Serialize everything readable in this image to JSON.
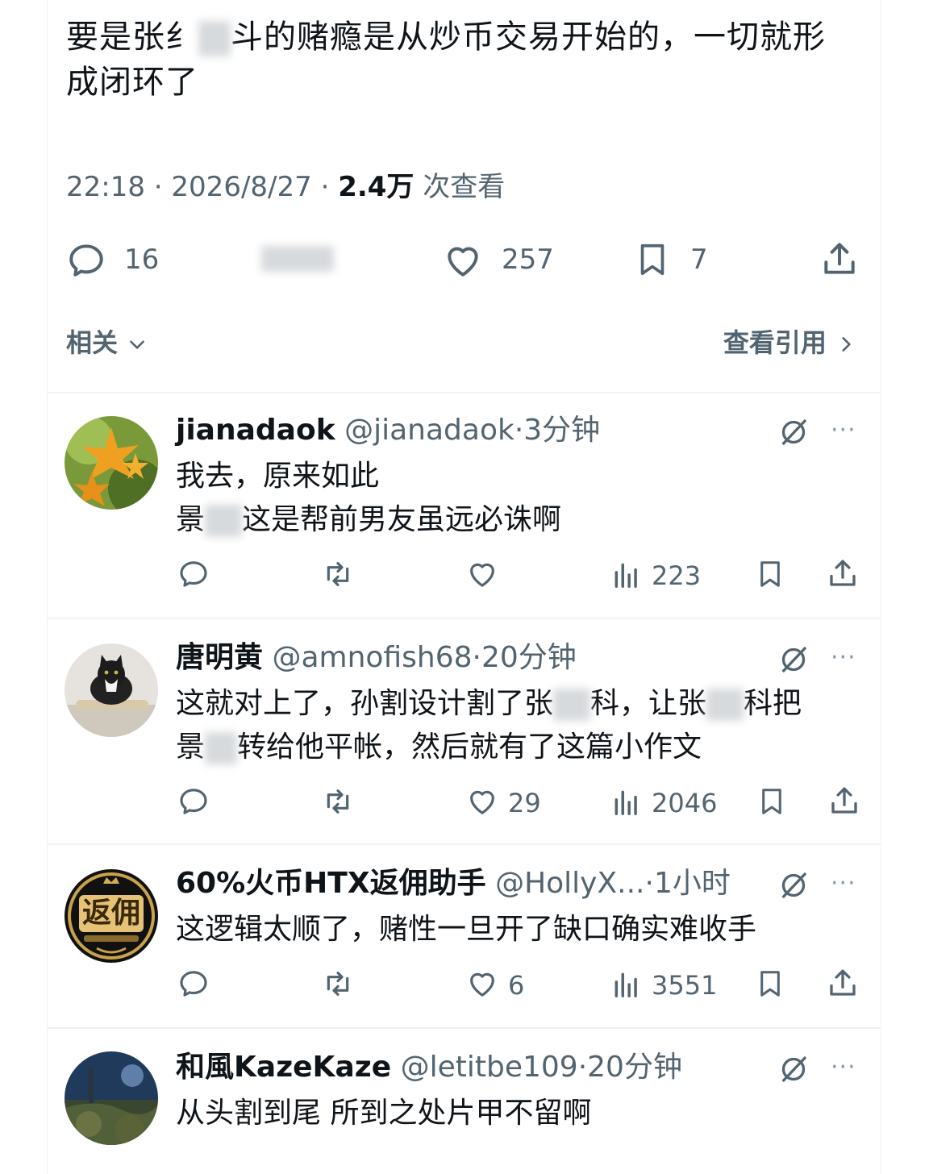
{
  "main_tweet": {
    "text_line1": "要是张纟▢斗的赌瘾是从炒币交易开始的，一切就形",
    "text_line2": "成闭环了",
    "time": "22:18",
    "date": "2026/8/27",
    "sep": "·",
    "views_count": "2.4万",
    "views_label": "次查看",
    "reply_count": "16",
    "like_count": "257",
    "bookmark_count": "7",
    "related_label": "相关",
    "quotes_label": "查看引用"
  },
  "replies": [
    {
      "name": "jianadaok",
      "handle": "@jianadaok",
      "time": "3分钟",
      "line1": "我去，原来如此",
      "line2a": "景",
      "line2b": "这是帮前男友虽远必诛啊",
      "likes": "",
      "views": "223"
    },
    {
      "name": "唐明黄",
      "handle": "@amnofish68",
      "time": "20分钟",
      "line1a": "这就对上了，孙割设计割了张",
      "line1b": "科，让张",
      "line1c": "科把",
      "line2a": "景",
      "line2b": "转给他平帐，然后就有了这篇小作文",
      "likes": "29",
      "views": "2046"
    },
    {
      "name": "60%火币HTX返佣助手",
      "handle": "@HollyX...",
      "time": "1小时",
      "line1": "这逻辑太顺了，赌性一旦开了缺口确实难收手",
      "likes": "6",
      "views": "3551",
      "avatar_text": "返佣"
    },
    {
      "name": "和風KazeKaze",
      "handle": "@letitbe109",
      "time": "20分钟",
      "line1": "从头割到尾 所到之处片甲不留啊"
    }
  ],
  "colors": {
    "text": "#0f1419",
    "secondary": "#536471",
    "divider": "#eff3f4"
  },
  "icons": [
    "reply-icon",
    "retweet-icon",
    "like-icon",
    "views-icon",
    "bookmark-icon",
    "share-icon",
    "grok-icon",
    "more-icon",
    "chevron-down-icon",
    "chevron-right-icon"
  ]
}
